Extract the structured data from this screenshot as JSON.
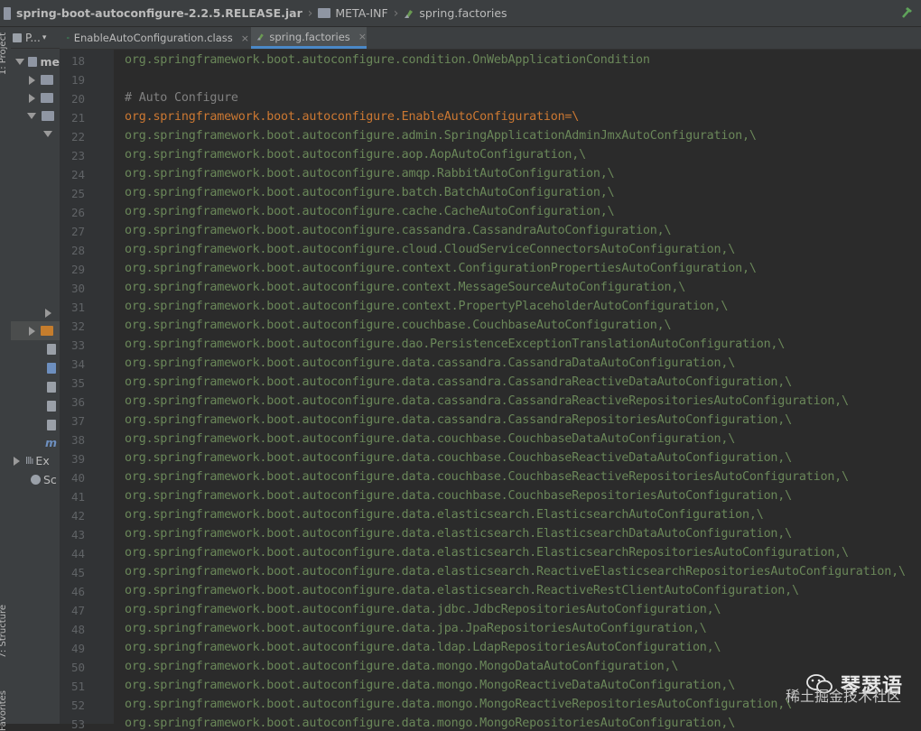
{
  "breadcrumb": {
    "jar": "spring-boot-autoconfigure-2.2.5.RELEASE.jar",
    "folder": "META-INF",
    "file": "spring.factories"
  },
  "side_labels": {
    "project": "1: Project",
    "structure": "7: Structure",
    "favorites": "Favorites"
  },
  "project_panel": {
    "header": "P...",
    "rows": [
      "me",
      "Ex",
      "Sc"
    ]
  },
  "tabs": [
    {
      "label": "EnableAutoConfiguration.class",
      "active": false
    },
    {
      "label": "spring.factories",
      "active": true
    }
  ],
  "editor": {
    "lines": [
      {
        "n": "18",
        "text": "org.springframework.boot.autoconfigure.condition.OnWebApplicationCondition",
        "kind": "value"
      },
      {
        "n": "19",
        "text": "",
        "kind": "value"
      },
      {
        "n": "20",
        "text": "# Auto Configure",
        "kind": "comment"
      },
      {
        "n": "21",
        "text": "org.springframework.boot.autoconfigure.EnableAutoConfiguration=\\",
        "kind": "key"
      },
      {
        "n": "22",
        "text": "org.springframework.boot.autoconfigure.admin.SpringApplicationAdminJmxAutoConfiguration,\\",
        "kind": "value"
      },
      {
        "n": "23",
        "text": "org.springframework.boot.autoconfigure.aop.AopAutoConfiguration,\\",
        "kind": "value"
      },
      {
        "n": "24",
        "text": "org.springframework.boot.autoconfigure.amqp.RabbitAutoConfiguration,\\",
        "kind": "value"
      },
      {
        "n": "25",
        "text": "org.springframework.boot.autoconfigure.batch.BatchAutoConfiguration,\\",
        "kind": "value"
      },
      {
        "n": "26",
        "text": "org.springframework.boot.autoconfigure.cache.CacheAutoConfiguration,\\",
        "kind": "value"
      },
      {
        "n": "27",
        "text": "org.springframework.boot.autoconfigure.cassandra.CassandraAutoConfiguration,\\",
        "kind": "value"
      },
      {
        "n": "28",
        "text": "org.springframework.boot.autoconfigure.cloud.CloudServiceConnectorsAutoConfiguration,\\",
        "kind": "value"
      },
      {
        "n": "29",
        "text": "org.springframework.boot.autoconfigure.context.ConfigurationPropertiesAutoConfiguration,\\",
        "kind": "value"
      },
      {
        "n": "30",
        "text": "org.springframework.boot.autoconfigure.context.MessageSourceAutoConfiguration,\\",
        "kind": "value"
      },
      {
        "n": "31",
        "text": "org.springframework.boot.autoconfigure.context.PropertyPlaceholderAutoConfiguration,\\",
        "kind": "value"
      },
      {
        "n": "32",
        "text": "org.springframework.boot.autoconfigure.couchbase.CouchbaseAutoConfiguration,\\",
        "kind": "value"
      },
      {
        "n": "33",
        "text": "org.springframework.boot.autoconfigure.dao.PersistenceExceptionTranslationAutoConfiguration,\\",
        "kind": "value"
      },
      {
        "n": "34",
        "text": "org.springframework.boot.autoconfigure.data.cassandra.CassandraDataAutoConfiguration,\\",
        "kind": "value"
      },
      {
        "n": "35",
        "text": "org.springframework.boot.autoconfigure.data.cassandra.CassandraReactiveDataAutoConfiguration,\\",
        "kind": "value"
      },
      {
        "n": "36",
        "text": "org.springframework.boot.autoconfigure.data.cassandra.CassandraReactiveRepositoriesAutoConfiguration,\\",
        "kind": "value"
      },
      {
        "n": "37",
        "text": "org.springframework.boot.autoconfigure.data.cassandra.CassandraRepositoriesAutoConfiguration,\\",
        "kind": "value"
      },
      {
        "n": "38",
        "text": "org.springframework.boot.autoconfigure.data.couchbase.CouchbaseDataAutoConfiguration,\\",
        "kind": "value"
      },
      {
        "n": "39",
        "text": "org.springframework.boot.autoconfigure.data.couchbase.CouchbaseReactiveDataAutoConfiguration,\\",
        "kind": "value"
      },
      {
        "n": "40",
        "text": "org.springframework.boot.autoconfigure.data.couchbase.CouchbaseReactiveRepositoriesAutoConfiguration,\\",
        "kind": "value"
      },
      {
        "n": "41",
        "text": "org.springframework.boot.autoconfigure.data.couchbase.CouchbaseRepositoriesAutoConfiguration,\\",
        "kind": "value"
      },
      {
        "n": "42",
        "text": "org.springframework.boot.autoconfigure.data.elasticsearch.ElasticsearchAutoConfiguration,\\",
        "kind": "value"
      },
      {
        "n": "43",
        "text": "org.springframework.boot.autoconfigure.data.elasticsearch.ElasticsearchDataAutoConfiguration,\\",
        "kind": "value"
      },
      {
        "n": "44",
        "text": "org.springframework.boot.autoconfigure.data.elasticsearch.ElasticsearchRepositoriesAutoConfiguration,\\",
        "kind": "value"
      },
      {
        "n": "45",
        "text": "org.springframework.boot.autoconfigure.data.elasticsearch.ReactiveElasticsearchRepositoriesAutoConfiguration,\\",
        "kind": "value"
      },
      {
        "n": "46",
        "text": "org.springframework.boot.autoconfigure.data.elasticsearch.ReactiveRestClientAutoConfiguration,\\",
        "kind": "value"
      },
      {
        "n": "47",
        "text": "org.springframework.boot.autoconfigure.data.jdbc.JdbcRepositoriesAutoConfiguration,\\",
        "kind": "value"
      },
      {
        "n": "48",
        "text": "org.springframework.boot.autoconfigure.data.jpa.JpaRepositoriesAutoConfiguration,\\",
        "kind": "value"
      },
      {
        "n": "49",
        "text": "org.springframework.boot.autoconfigure.data.ldap.LdapRepositoriesAutoConfiguration,\\",
        "kind": "value"
      },
      {
        "n": "50",
        "text": "org.springframework.boot.autoconfigure.data.mongo.MongoDataAutoConfiguration,\\",
        "kind": "value"
      },
      {
        "n": "51",
        "text": "org.springframework.boot.autoconfigure.data.mongo.MongoReactiveDataAutoConfiguration,\\",
        "kind": "value"
      },
      {
        "n": "52",
        "text": "org.springframework.boot.autoconfigure.data.mongo.MongoReactiveRepositoriesAutoConfiguration,\\",
        "kind": "value"
      },
      {
        "n": "53",
        "text": "org.springframework.boot.autoconfigure.data.mongo.MongoRepositoriesAutoConfiguration,\\",
        "kind": "value"
      }
    ]
  },
  "watermark": {
    "title": "琴瑟语",
    "subtitle": "稀土掘金技术社区"
  },
  "colors": {
    "value": "#6a8759",
    "key": "#cc7832",
    "comment": "#808080",
    "line_number": "#606366"
  }
}
